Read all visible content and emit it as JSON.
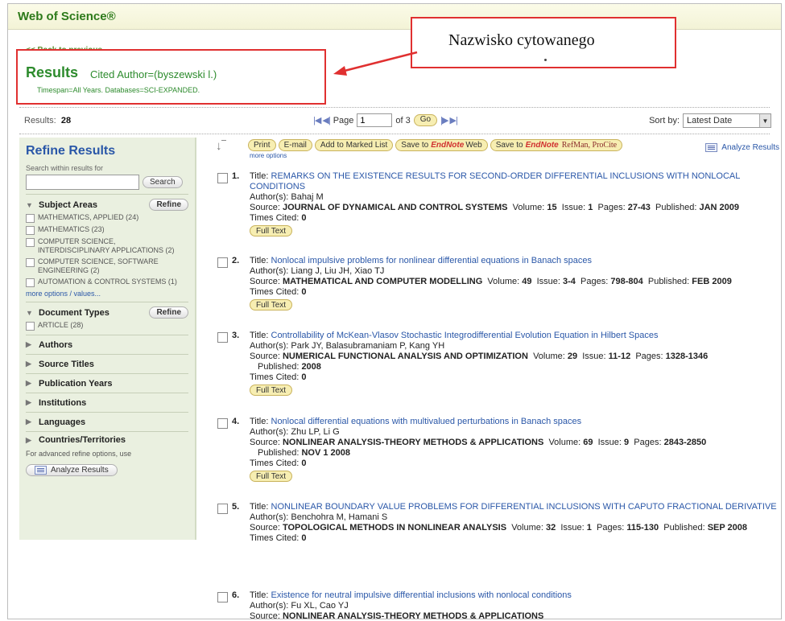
{
  "header": {
    "title": "Web of Science®"
  },
  "back_link": "<< Back to previous",
  "summary": {
    "heading": "Results",
    "query": "Cited Author=(byszewski l.)",
    "timespan": "Timespan=All Years. Databases=SCI-EXPANDED."
  },
  "callout": {
    "text": "Nazwisko cytowanego"
  },
  "results_bar": {
    "label": "Results:",
    "count": "28",
    "page_label": "Page",
    "page_value": "1",
    "of_label": "of 3",
    "go_label": "Go",
    "sort_label": "Sort by:",
    "sort_value": "Latest Date"
  },
  "sidebar": {
    "title": "Refine Results",
    "search_hint": "Search within results for",
    "search_button": "Search",
    "subject_areas": {
      "label": "Subject Areas",
      "refine": "Refine",
      "items": [
        "MATHEMATICS, APPLIED (24)",
        "MATHEMATICS (23)",
        "COMPUTER SCIENCE, INTERDISCIPLINARY APPLICATIONS (2)",
        "COMPUTER SCIENCE, SOFTWARE ENGINEERING (2)",
        "AUTOMATION & CONTROL SYSTEMS (1)"
      ],
      "more": "more options / values..."
    },
    "document_types": {
      "label": "Document Types",
      "refine": "Refine",
      "items": [
        "ARTICLE (28)"
      ]
    },
    "collapsed": [
      "Authors",
      "Source Titles",
      "Publication Years",
      "Institutions",
      "Languages"
    ],
    "countries": "Countries/Territories",
    "advanced_text": "For advanced refine options, use",
    "analyze_button": "Analyze Results"
  },
  "actions": {
    "print": "Print",
    "email": "E-mail",
    "marked": "Add to Marked List",
    "save_to": "Save to",
    "endnote": "EndNote",
    "web": "Web",
    "save_to2": "Save to",
    "endnote2": "EndNote",
    "refman": "RefMan, ProCite",
    "more_options": "more options",
    "analyze": "Analyze Results"
  },
  "labels": {
    "title": "Title:",
    "authors": "Author(s):",
    "source": "Source:",
    "volume": "Volume:",
    "issue": "Issue:",
    "pages": "Pages:",
    "published": "Published:",
    "times_cited": "Times Cited:",
    "full_text": "Full Text"
  },
  "records": [
    {
      "num": "1.",
      "title": "REMARKS ON THE EXISTENCE RESULTS FOR SECOND-ORDER DIFFERENTIAL INCLUSIONS WITH NONLOCAL CONDITIONS",
      "authors": "Bahaj M",
      "source": "JOURNAL OF DYNAMICAL AND CONTROL SYSTEMS",
      "volume": "15",
      "issue": "1",
      "pages": "27-43",
      "published": "JAN 2009",
      "cited": "0"
    },
    {
      "num": "2.",
      "title": "Nonlocal impulsive problems for nonlinear differential equations in Banach spaces",
      "authors": "Liang J, Liu JH, Xiao TJ",
      "source": "MATHEMATICAL AND COMPUTER MODELLING",
      "volume": "49",
      "issue": "3-4",
      "pages": "798-804",
      "published": "FEB 2009",
      "cited": "0"
    },
    {
      "num": "3.",
      "title": "Controllability of McKean-Vlasov Stochastic Integrodifferential Evolution Equation in Hilbert Spaces",
      "authors": "Park JY, Balasubramaniam P, Kang YH",
      "source": "NUMERICAL FUNCTIONAL ANALYSIS AND OPTIMIZATION",
      "volume": "29",
      "issue": "11-12",
      "pages": "1328-1346",
      "published": "2008",
      "cited": "0"
    },
    {
      "num": "4.",
      "title": "Nonlocal differential equations with multivalued perturbations in Banach spaces",
      "authors": "Zhu LP, Li G",
      "source": "NONLINEAR ANALYSIS-THEORY METHODS & APPLICATIONS",
      "volume": "69",
      "issue": "9",
      "pages": "2843-2850",
      "published": "NOV 1 2008",
      "cited": "0"
    },
    {
      "num": "5.",
      "title": "NONLINEAR BOUNDARY VALUE PROBLEMS FOR DIFFERENTIAL INCLUSIONS WITH CAPUTO FRACTIONAL DERIVATIVE",
      "authors": "Benchohra M, Hamani S",
      "source": "TOPOLOGICAL METHODS IN NONLINEAR ANALYSIS",
      "volume": "32",
      "issue": "1",
      "pages": "115-130",
      "published": "SEP 2008",
      "cited": "0"
    },
    {
      "num": "6.",
      "title": "Existence for neutral impulsive differential inclusions with nonlocal conditions",
      "authors": "Fu XL, Cao YJ",
      "source": "NONLINEAR ANALYSIS-THEORY METHODS & APPLICATIONS"
    }
  ]
}
